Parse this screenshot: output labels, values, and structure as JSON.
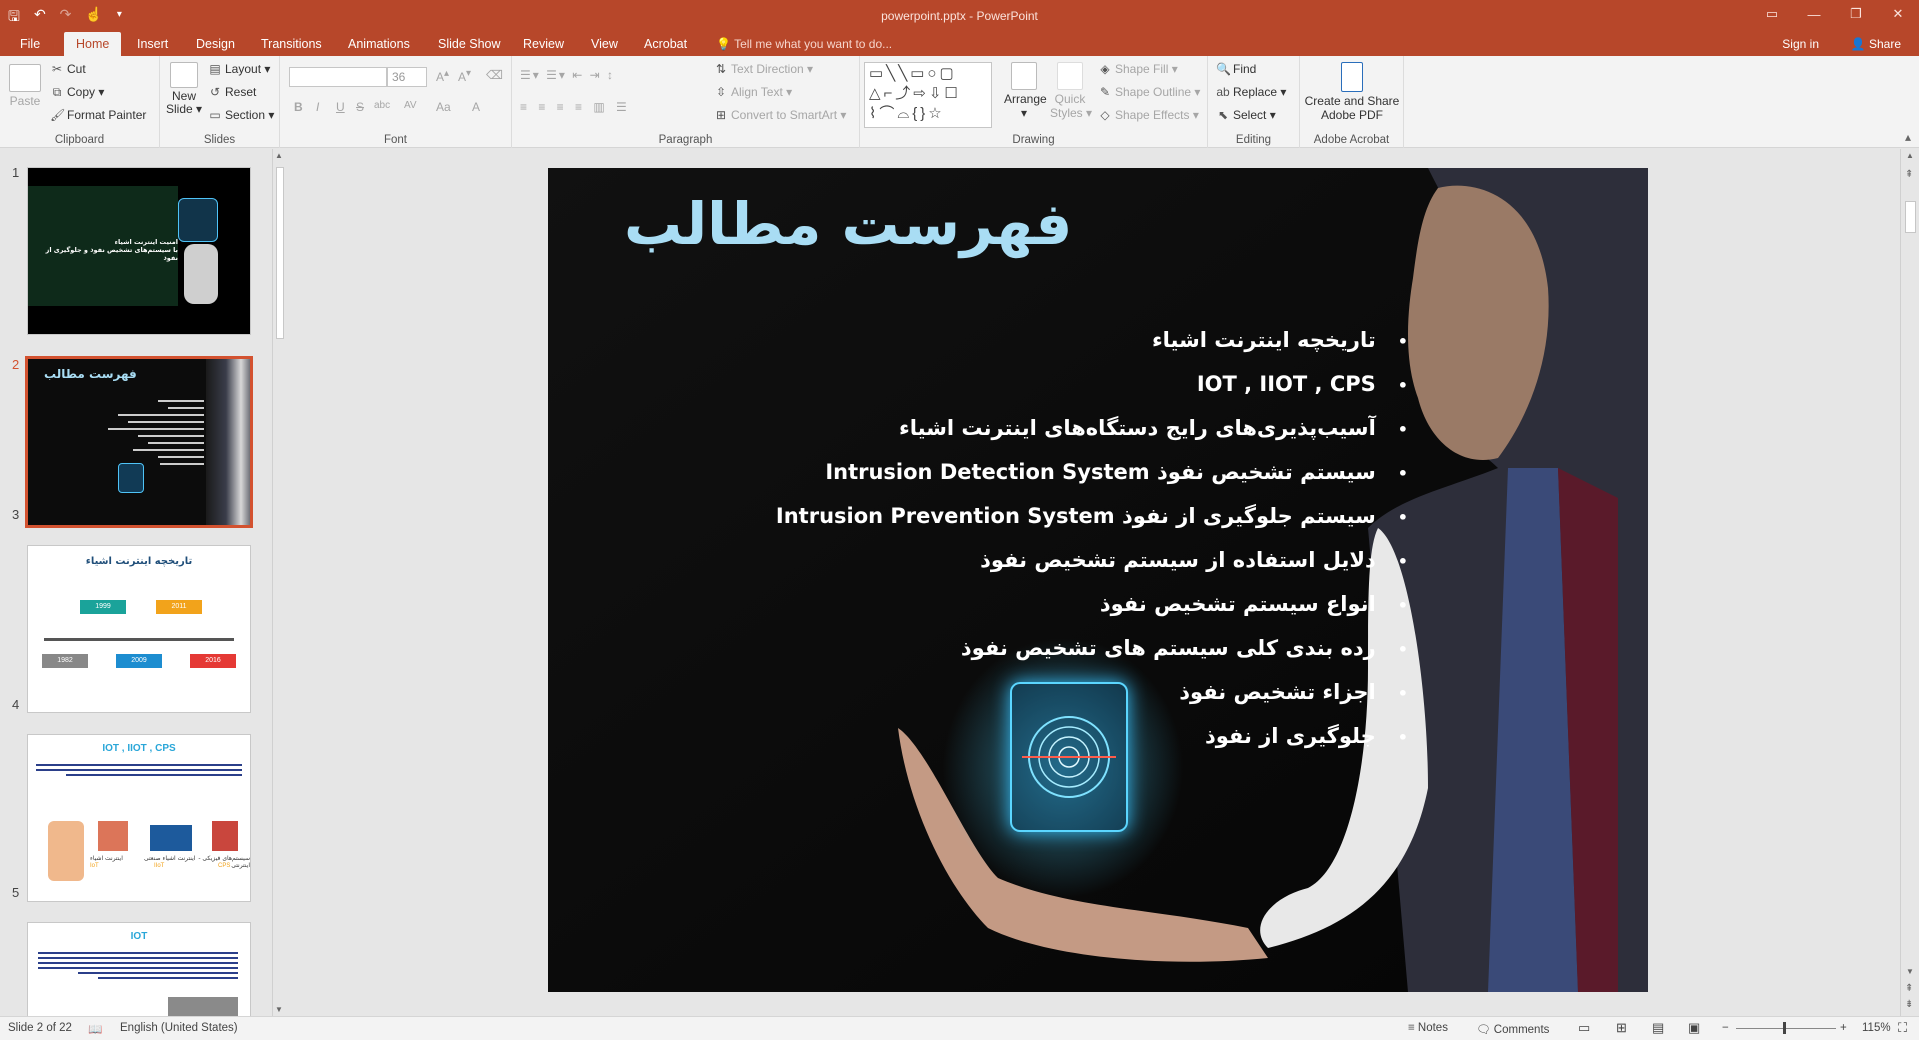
{
  "window": {
    "doc_title": "powerpoint.pptx - PowerPoint",
    "controls": [
      "▭",
      "—",
      "❐",
      "✕"
    ]
  },
  "qat": [
    "save-icon",
    "undo-icon",
    "redo-icon",
    "touch-mode-icon",
    "customize-icon"
  ],
  "tabs": [
    {
      "label": "File"
    },
    {
      "label": "Home"
    },
    {
      "label": "Insert"
    },
    {
      "label": "Design"
    },
    {
      "label": "Transitions"
    },
    {
      "label": "Animations"
    },
    {
      "label": "Slide Show"
    },
    {
      "label": "Review"
    },
    {
      "label": "View"
    },
    {
      "label": "Acrobat"
    }
  ],
  "tell_me": "Tell me what you want to do...",
  "sign_in": "Sign in",
  "share": "Share",
  "ribbon": {
    "clipboard": {
      "label": "Clipboard",
      "paste": "Paste",
      "cut": "Cut",
      "copy": "Copy",
      "format_painter": "Format Painter"
    },
    "slides": {
      "label": "Slides",
      "new_slide": "New",
      "new_slide2": "Slide",
      "layout": "Layout",
      "reset": "Reset",
      "section": "Section"
    },
    "font": {
      "label": "Font",
      "size": "36",
      "bold": "B",
      "italic": "I",
      "underline": "U",
      "strike": "S",
      "shadow": "abc",
      "spacing": "AV",
      "case": "Aa",
      "color": "A"
    },
    "paragraph": {
      "label": "Paragraph",
      "text_direction": "Text Direction",
      "align_text": "Align Text",
      "smartart": "Convert to SmartArt"
    },
    "drawing": {
      "label": "Drawing",
      "arrange": "Arrange",
      "quick_styles": "Quick",
      "quick_styles2": "Styles",
      "shape_fill": "Shape Fill",
      "shape_outline": "Shape Outline",
      "shape_effects": "Shape Effects"
    },
    "editing": {
      "label": "Editing",
      "find": "Find",
      "replace": "Replace",
      "select": "Select"
    },
    "acrobat": {
      "label": "Adobe Acrobat",
      "create_share": "Create and Share",
      "create_share2": "Adobe PDF"
    }
  },
  "thumbnails": {
    "numbers": [
      "1",
      "2",
      "3",
      "4",
      "5"
    ],
    "t1": {
      "line1": "امنیت اینترنت اشیاء",
      "line2": "با سیستم‌های تشخیص نفوذ و جلوگیری از نفوذ"
    },
    "t2": {
      "title": "فهرست مطالب"
    },
    "t3": {
      "title": "تاریخچه  اینترنت اشیاء",
      "years": [
        "1999",
        "2011",
        "1982",
        "2009",
        "2016"
      ]
    },
    "t4": {
      "title": "IOT , IIOT , CPS",
      "c1": "اینترنت اشیاء",
      "c2": "اینترنت اشیاء صنعتی",
      "c3": "سیستم‌های فیزیکی - اینترنتی",
      "s1": "IoT",
      "s2": "IIoT",
      "s3": "CPS"
    },
    "t5": {
      "title": "IOT"
    }
  },
  "slide": {
    "title": "فهرست مطالب",
    "items": [
      "تاریخچه  اینترنت اشیاء",
      "IOT , IIOT , CPS",
      "آسیب‌پذیری‌های رایج دستگاه‌های اینترنت اشیاء",
      "سیستم تشخیص نفوذ Intrusion Detection System",
      "سیستم جلوگیری از نفوذ Intrusion Prevention System",
      "دلایل استفاده از سیستم تشخیص نفوذ",
      "انواع سیستم تشخیص نفوذ",
      "رده بندی کلی سیستم های تشخیص نفوذ",
      "اجزاء تشخیص نفوذ",
      "جلوگیری از نفوذ"
    ],
    "bullet": "•"
  },
  "status": {
    "slide_info": "Slide 2 of 22",
    "language": "English (United States)",
    "notes": "Notes",
    "comments": "Comments",
    "zoom": "115%"
  },
  "colors": {
    "accent": "#b7472a",
    "slide_title": "#a9ddf4",
    "selection": "#d35230"
  }
}
